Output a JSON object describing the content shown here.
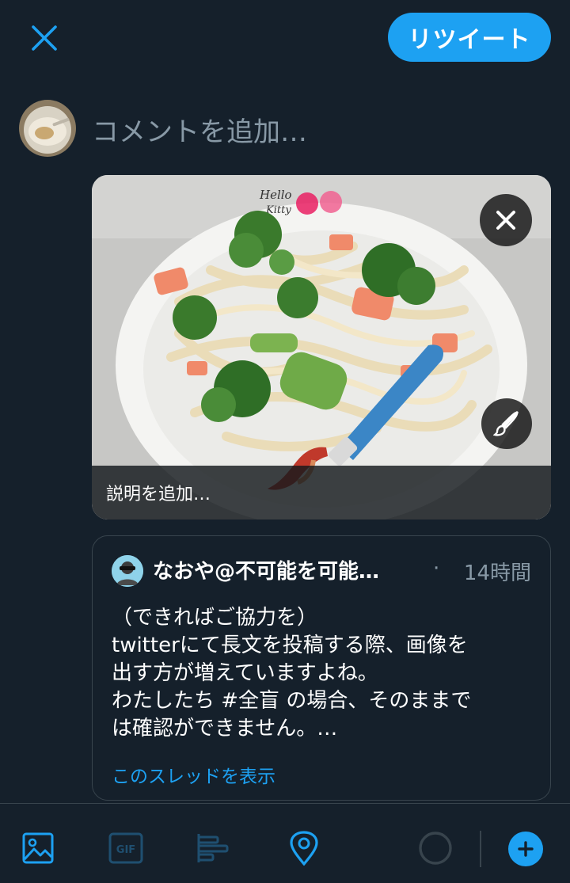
{
  "header": {
    "close_icon": "close-icon",
    "retweet_label": "リツイート"
  },
  "compose": {
    "placeholder": "コメントを追加…"
  },
  "media": {
    "alt_text_prompt": "説明を追加…",
    "remove_icon": "close-icon",
    "edit_icon": "paintbrush-icon"
  },
  "quote": {
    "author_name": "なおや@不可能を可能…",
    "separator": "·",
    "timestamp": "14時間",
    "lines": [
      "（できればご協力を）",
      "twitterにて長文を投稿する際、画像を",
      "出す方が増えていますよね。",
      "わたしたち #全盲 の場合、そのままで",
      "は確認ができません。…"
    ],
    "show_thread": "このスレッドを表示"
  },
  "toolbar": {
    "items": [
      "image-icon",
      "gif-icon",
      "poll-icon",
      "location-icon",
      "character-counter-ring",
      "add-tweet-icon"
    ],
    "gif_label": "GIF"
  },
  "colors": {
    "background": "#15202b",
    "accent": "#1da1f2",
    "muted_text": "#8899a6",
    "border": "#38444d"
  }
}
